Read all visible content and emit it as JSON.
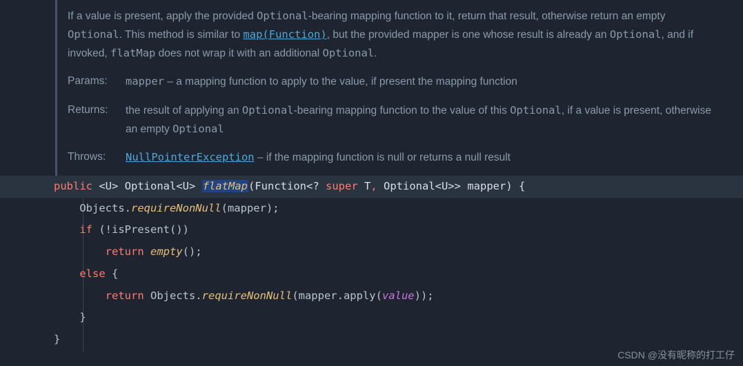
{
  "javadoc": {
    "description": {
      "p1_a": "If a value is present, apply the provided ",
      "opt1": "Optional",
      "p1_b": "-bearing mapping function to it, return that result, otherwise return an empty ",
      "opt2": "Optional",
      "p1_c": ". This method is similar to ",
      "link": "map(Function)",
      "p1_d": ", but the provided mapper is one whose result is already an ",
      "opt3": "Optional",
      "p1_e": ", and if invoked, ",
      "flatmap": "flatMap",
      "p1_f": " does not wrap it with an additional ",
      "opt4": "Optional",
      "p1_g": "."
    },
    "params_label": "Params:",
    "params_value": {
      "name": "mapper",
      "desc": " – a mapping function to apply to the value, if present the mapping function"
    },
    "returns_label": "Returns:",
    "returns_value": {
      "a": "the result of applying an ",
      "opt1": "Optional",
      "b": "-bearing mapping function to the value of this ",
      "opt2": "Optional",
      "c": ", if a value is present, otherwise an empty ",
      "opt3": "Optional"
    },
    "throws_label": "Throws:",
    "throws_value": {
      "exc": "NullPointerException",
      "desc": " – if the mapping function is null or returns a null result"
    }
  },
  "code": {
    "l1": {
      "public": "public",
      "generic": "<U>",
      "type": "Optional<U>",
      "method": "flatMap",
      "sig1": "(Function<? ",
      "super": "super",
      "sig2": " T",
      "comma": ",",
      "sig3": " Optional<U>> mapper) {"
    },
    "l2": {
      "a": "    Objects.",
      "m": "requireNonNull",
      "b": "(mapper);"
    },
    "l3": {
      "if": "if",
      "a": " (!isPresent())"
    },
    "l4": {
      "return": "return",
      "m": "empty",
      "b": "();"
    },
    "l5": {
      "else": "else",
      "b": " {"
    },
    "l6": {
      "return": "return",
      "a": " Objects.",
      "m": "requireNonNull",
      "b": "(mapper.apply(",
      "v": "value",
      "c": "));"
    },
    "l7": "    }",
    "l8": "}"
  },
  "watermark": "CSDN @没有昵称的打工仔"
}
